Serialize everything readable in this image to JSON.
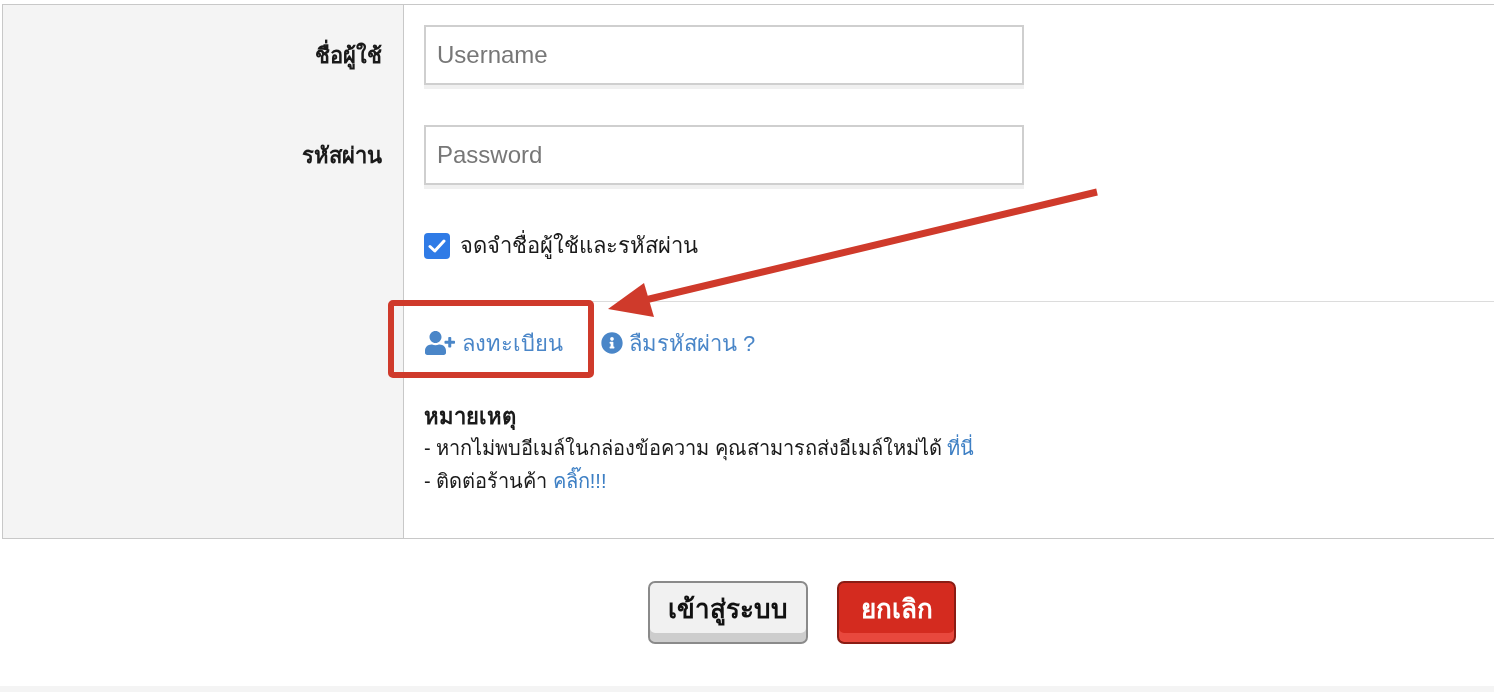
{
  "login_form": {
    "fields": [
      {
        "label": "ชื่อผู้ใช้",
        "placeholder": "Username"
      },
      {
        "label": "รหัสผ่าน",
        "placeholder": "Password"
      }
    ],
    "remember": {
      "label": "จดจำชื่อผู้ใช้และรหัสผ่าน",
      "checked": true
    },
    "links": [
      {
        "label": "ลงทะเบียน",
        "kind": "register",
        "highlighted": true
      },
      {
        "label": "ลืมรหัสผ่าน ?",
        "kind": "info",
        "highlighted": false
      }
    ],
    "note": {
      "title": "หมายเหตุ",
      "lines": [
        {
          "text": "- หากไม่พบอีเมล์ในกล่องข้อความ คุณสามารถส่งอีเมล์ใหม่ได้",
          "link": "ที่นี่"
        },
        {
          "text": "- ติดต่อร้านค้า",
          "link": "คลิ๊ก!!!"
        }
      ]
    }
  },
  "buttons": [
    {
      "label": "เข้าสู่ระบบ",
      "kind": "default"
    },
    {
      "label": "ยกเลิก",
      "kind": "danger"
    }
  ]
}
